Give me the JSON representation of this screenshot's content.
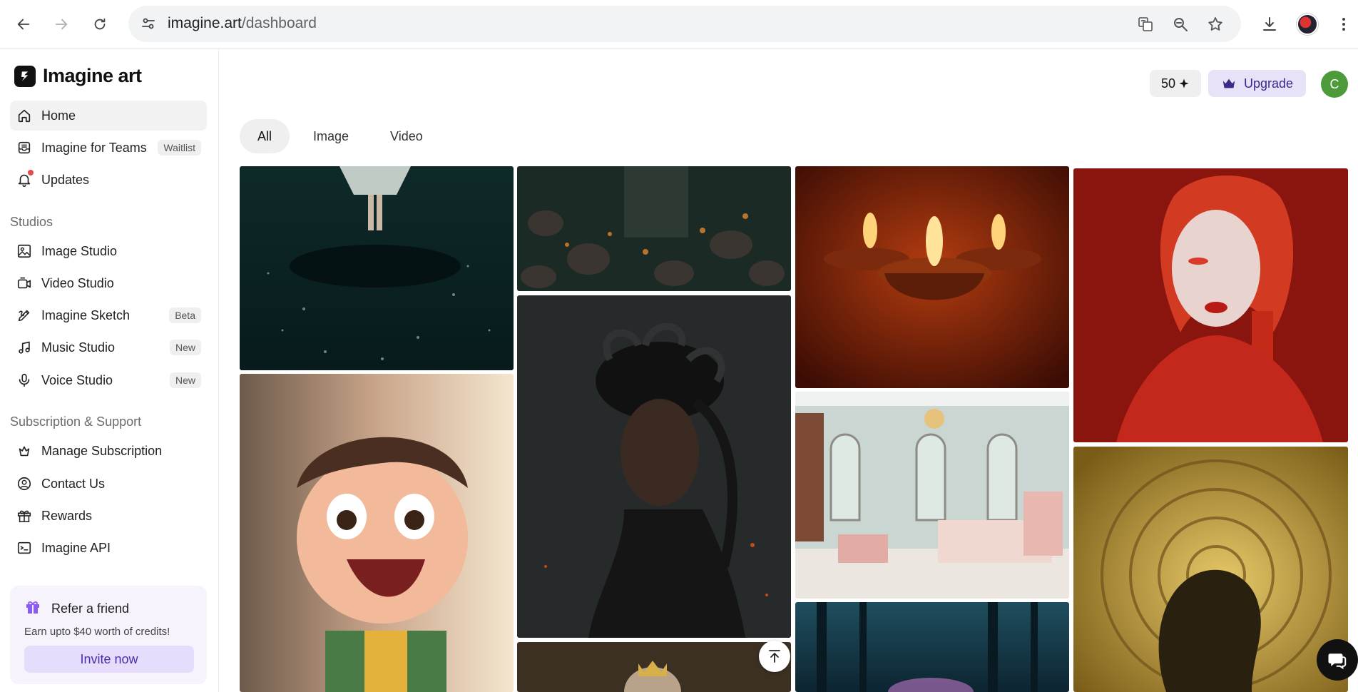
{
  "browser": {
    "url_host": "imagine.art",
    "url_path": "/dashboard"
  },
  "sidebar": {
    "brand": "Imagine art",
    "items_top": [
      {
        "label": "Home",
        "icon": "home-icon"
      },
      {
        "label": "Imagine for Teams",
        "icon": "teams-icon",
        "badge": "Waitlist"
      },
      {
        "label": "Updates",
        "icon": "bell-icon"
      }
    ],
    "studios_title": "Studios",
    "studios": [
      {
        "label": "Image Studio",
        "icon": "image-icon"
      },
      {
        "label": "Video Studio",
        "icon": "video-icon"
      },
      {
        "label": "Imagine Sketch",
        "icon": "pen-icon",
        "badge": "Beta"
      },
      {
        "label": "Music Studio",
        "icon": "music-icon",
        "badge": "New"
      },
      {
        "label": "Voice Studio",
        "icon": "microphone-icon",
        "badge": "New"
      }
    ],
    "support_title": "Subscription & Support",
    "support": [
      {
        "label": "Manage Subscription",
        "icon": "subscription-icon"
      },
      {
        "label": "Contact Us",
        "icon": "contact-icon"
      },
      {
        "label": "Rewards",
        "icon": "gift-icon"
      },
      {
        "label": "Imagine API",
        "icon": "api-icon"
      }
    ],
    "refer": {
      "title": "Refer a friend",
      "description": "Earn upto $40 worth of credits!",
      "button": "Invite now"
    }
  },
  "header": {
    "credits": "50",
    "upgrade": "Upgrade",
    "avatar_initial": "C"
  },
  "tabs": [
    "All",
    "Image",
    "Video"
  ],
  "colors": {
    "accent": "#4b2ea8",
    "avatar_bg": "#4c9a3a"
  }
}
